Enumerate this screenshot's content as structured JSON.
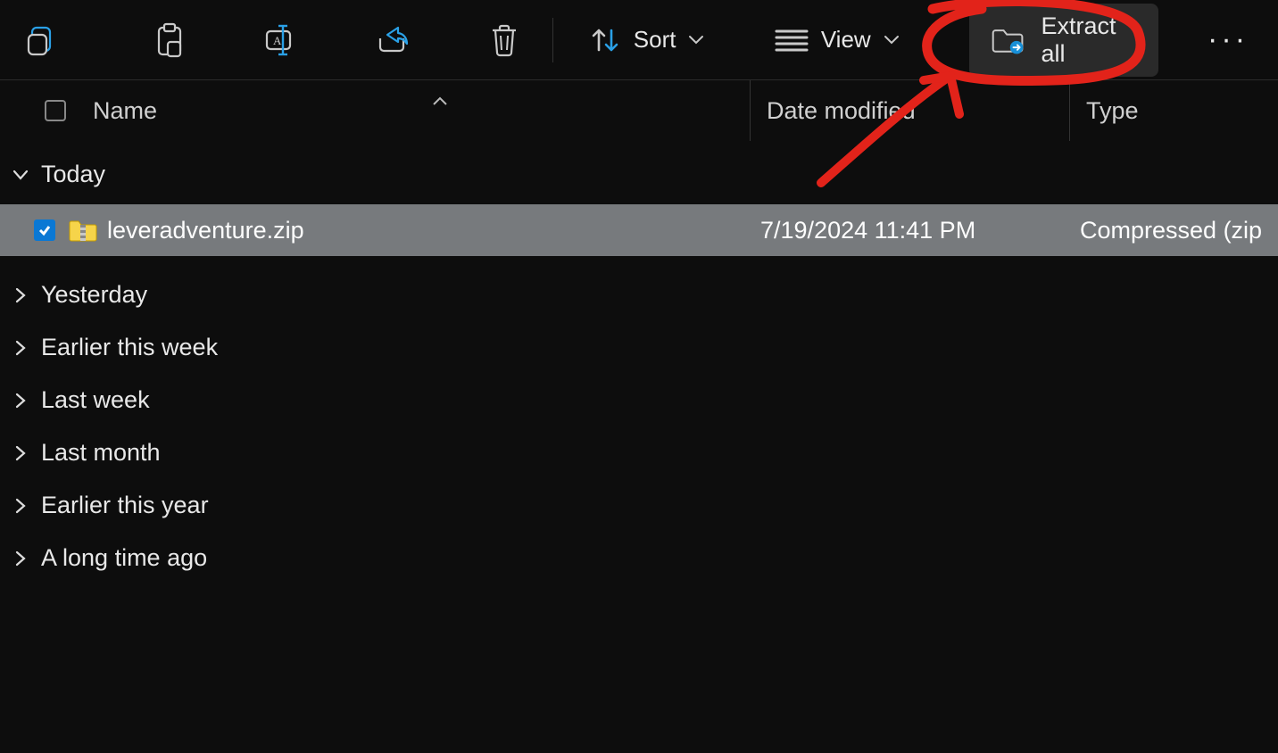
{
  "toolbar": {
    "sort_label": "Sort",
    "view_label": "View",
    "extract_label": "Extract all",
    "more_label": "···"
  },
  "columns": {
    "name": "Name",
    "date": "Date modified",
    "type": "Type"
  },
  "groups": [
    {
      "label": "Today",
      "expanded": true
    },
    {
      "label": "Yesterday",
      "expanded": false
    },
    {
      "label": "Earlier this week",
      "expanded": false
    },
    {
      "label": "Last week",
      "expanded": false
    },
    {
      "label": "Last month",
      "expanded": false
    },
    {
      "label": "Earlier this year",
      "expanded": false
    },
    {
      "label": "A long time ago",
      "expanded": false
    }
  ],
  "files": {
    "today": [
      {
        "name": "leveradventure.zip",
        "date_modified": "7/19/2024 11:41 PM",
        "type": "Compressed (zip",
        "selected": true
      }
    ]
  }
}
